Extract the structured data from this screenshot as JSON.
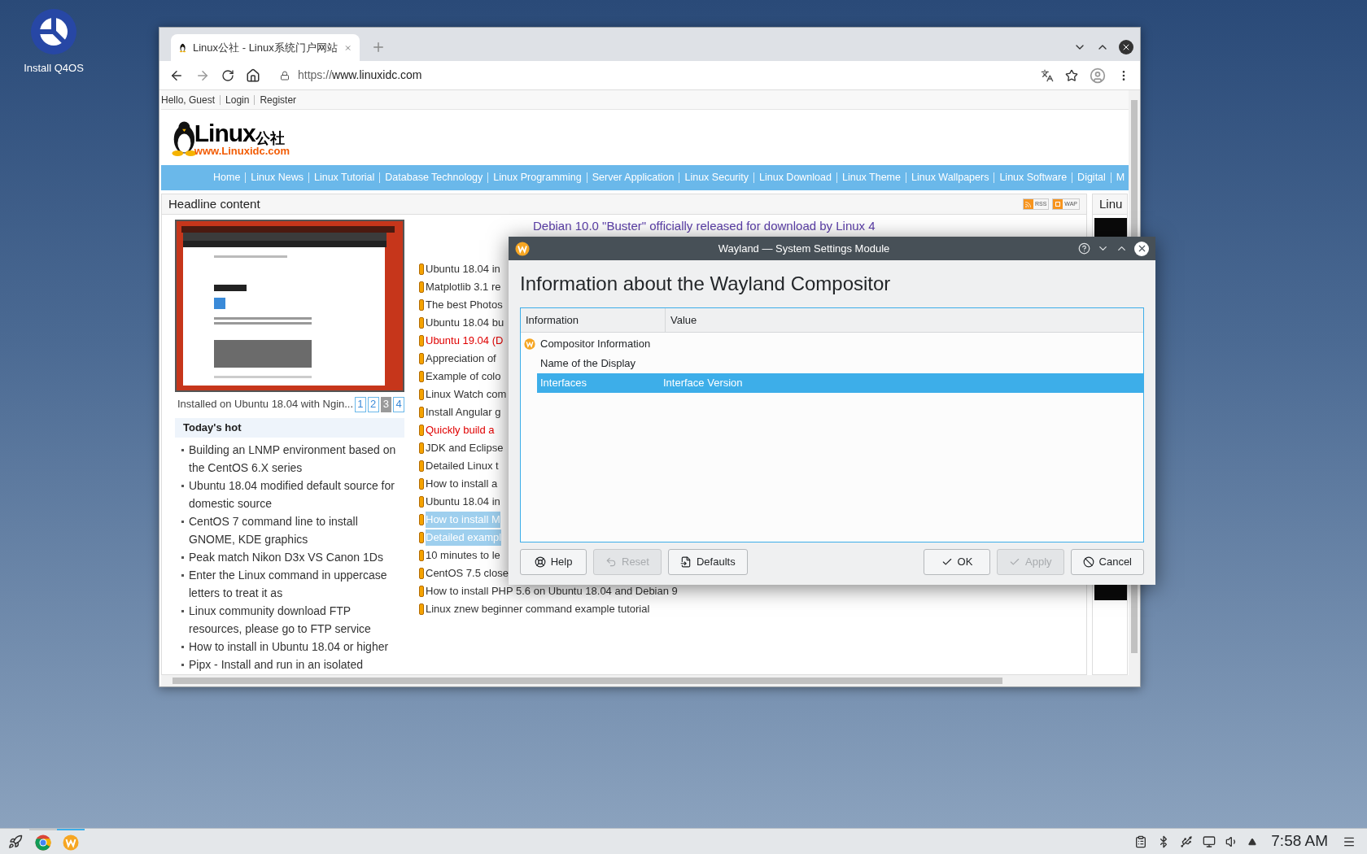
{
  "desktop_icons": [
    {
      "label": "Install Q4OS"
    }
  ],
  "browser": {
    "tab": {
      "title": "Linux公社 - Linux系统门户网站"
    },
    "url": {
      "scheme": "https://",
      "host": "www.linuxidc.com"
    },
    "page": {
      "user_links": [
        "Hello, Guest",
        "Login",
        "Register"
      ],
      "logo": {
        "word": "Linux",
        "suffix": "公社",
        "site": "www.Linuxidc.com"
      },
      "nav": [
        "Home",
        "Linux News",
        "Linux Tutorial",
        "Database Technology",
        "Linux Programming",
        "Server Application",
        "Linux Security",
        "Linux Download",
        "Linux Theme",
        "Linux Wallpapers",
        "Linux Software",
        "Digital",
        "M"
      ],
      "headline": {
        "title": "Headline content",
        "badges": [
          "RSS",
          "WAP"
        ]
      },
      "slideshow": {
        "caption": "Installed on Ubuntu 18.04 with Ngin...",
        "pages": [
          {
            "label": "1",
            "selected": false
          },
          {
            "label": "2",
            "selected": false
          },
          {
            "label": "3",
            "selected": true
          },
          {
            "label": "4",
            "selected": false
          }
        ]
      },
      "hot": {
        "title": "Today's hot",
        "items": [
          "Building an LNMP environment based on the CentOS 6.X series",
          "Ubuntu 18.04 modified default source for domestic source",
          "CentOS 7 command line to install GNOME, KDE graphics",
          "Peak match Nikon D3x VS Canon 1Ds",
          "Enter the Linux command in uppercase letters to treat it as",
          "Linux community download FTP resources, please go to FTP service",
          "How to install in Ubuntu 18.04 or higher",
          "Pipx - Install and run in an isolated"
        ]
      },
      "featured": "Debian 10.0 \"Buster\" officially released for download by Linux 4",
      "articles": [
        {
          "title": "Ubuntu 18.04 in",
          "kind": "normal"
        },
        {
          "title": "Matplotlib 3.1 re",
          "kind": "normal"
        },
        {
          "title": "The best Photos",
          "kind": "normal"
        },
        {
          "title": "Ubuntu 18.04 bu",
          "kind": "normal"
        },
        {
          "title": "Ubuntu 19.04 (D",
          "kind": "hot"
        },
        {
          "title": "Appreciation of",
          "kind": "normal"
        },
        {
          "title": "Example of colo",
          "kind": "normal"
        },
        {
          "title": "Linux Watch com",
          "kind": "normal"
        },
        {
          "title": "Install Angular g",
          "kind": "normal"
        },
        {
          "title": "Quickly build a",
          "kind": "hot"
        },
        {
          "title": "JDK and Eclipse",
          "kind": "normal"
        },
        {
          "title": "Detailed Linux t",
          "kind": "normal"
        },
        {
          "title": "How to install a",
          "kind": "normal"
        },
        {
          "title": "Ubuntu 18.04 in",
          "kind": "normal"
        },
        {
          "title": "How to install M",
          "kind": "highlighted"
        },
        {
          "title": "Detailed exampl",
          "kind": "highlighted"
        },
        {
          "title": "10 minutes to le",
          "kind": "normal"
        },
        {
          "title": "CentOS 7.5 close",
          "kind": "normal"
        },
        {
          "title": "How to install PHP 5.6 on Ubuntu 18.04 and Debian 9",
          "kind": "normal"
        },
        {
          "title": "Linux znew beginner command example tutorial",
          "kind": "normal"
        }
      ],
      "sidebar": {
        "title": "Linu"
      }
    }
  },
  "dialog": {
    "title": "Wayland — System Settings Module",
    "heading": "Information about the Wayland Compositor",
    "columns": [
      "Information",
      "Value"
    ],
    "tree": [
      {
        "label": "Compositor Information",
        "selected": false,
        "children": [
          {
            "label": "Name of the Display",
            "selected": false
          },
          {
            "label": "Interfaces",
            "value": "Interface Version",
            "selected": true
          }
        ]
      }
    ],
    "buttons": [
      {
        "label": "Help",
        "kind": "help",
        "disabled": false
      },
      {
        "label": "Reset",
        "kind": "reset",
        "disabled": true
      },
      {
        "label": "Defaults",
        "kind": "defaults",
        "disabled": false
      },
      {
        "label": "OK",
        "kind": "ok",
        "disabled": false
      },
      {
        "label": "Apply",
        "kind": "apply",
        "disabled": true
      },
      {
        "label": "Cancel",
        "kind": "cancel",
        "disabled": false
      }
    ]
  },
  "taskbar": {
    "tasks": [
      {
        "kind": "browser",
        "selected": false
      },
      {
        "kind": "settings",
        "selected": true
      }
    ],
    "clock": "7:58 AM"
  }
}
